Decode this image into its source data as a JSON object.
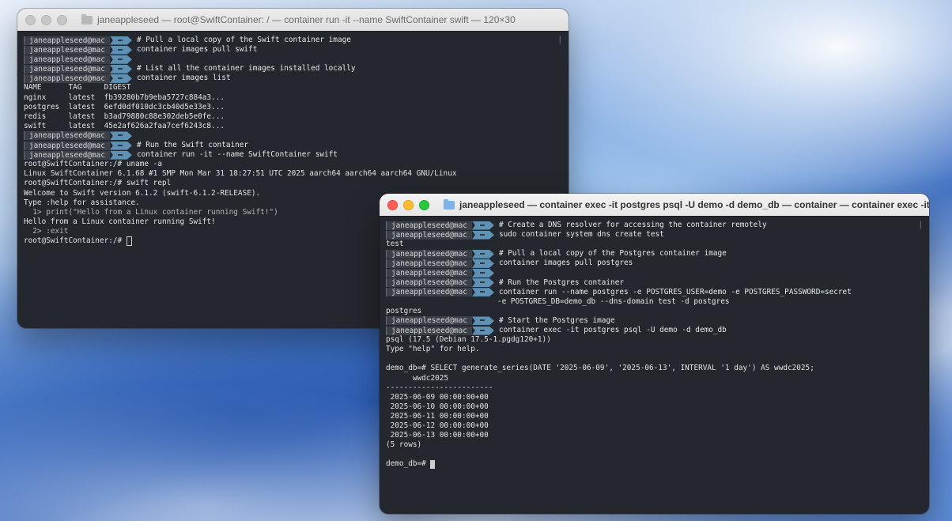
{
  "window1": {
    "title": "janeappleseed — root@SwiftContainer: / — container run -it --name SwiftContainer swift — 120×30",
    "user": "janeappleseed@mac",
    "tilde": "~",
    "lines": {
      "l1": "# Pull a local copy of the Swift container image",
      "l2": "container images pull swift",
      "l4": "# List all the container images installed locally",
      "l5": "container images list",
      "h": "NAME      TAG     DIGEST",
      "r1": "nginx     latest  fb39280b7b9eba5727c884a3...",
      "r2": "postgres  latest  6efd0df010dc3cb40d5e33e3...",
      "r3": "redis     latest  b3ad79880c88e302deb5e0fe...",
      "r4": "swift     latest  45e2af626a2faa7cef6243c8...",
      "l8": "# Run the Swift container",
      "l9": "container run -it --name SwiftContainer swift",
      "o1": "root@SwiftContainer:/# uname -a",
      "o2": "Linux SwiftContainer 6.1.68 #1 SMP Mon Mar 31 18:27:51 UTC 2025 aarch64 aarch64 aarch64 GNU/Linux",
      "o3": "root@SwiftContainer:/# swift repl",
      "o4": "Welcome to Swift version 6.1.2 (swift-6.1.2-RELEASE).",
      "o5": "Type :help for assistance.",
      "o6": "  1> print(\"Hello from a Linux container running Swift!\")",
      "o7": "Hello from a Linux container running Swift!",
      "o8": "  2> :exit",
      "o9": "root@SwiftContainer:/# "
    }
  },
  "window2": {
    "title": "janeappleseed — container exec -it postgres psql -U demo -d demo_db — container — container exec -it postgres ps...",
    "user": "janeappleseed@mac",
    "tilde": "~",
    "lines": {
      "a1": "# Create a DNS resolver for accessing the container remotely",
      "a2": "sudo container system dns create test",
      "a3": "test",
      "b1": "# Pull a local copy of the Postgres container image",
      "b2": "container images pull postgres",
      "c1": "# Run the Postgres container",
      "c2": "container run --name postgres -e POSTGRES_USER=demo -e POSTGRES_PASSWORD=secret",
      "c3": "-e POSTGRES_DB=demo_db --dns-domain test -d postgres",
      "c4": "postgres",
      "d1": "# Start the Postgres image",
      "d2": "container exec -it postgres psql -U demo -d demo_db",
      "d3": "psql (17.5 (Debian 17.5-1.pgdg120+1))",
      "d4": "Type \"help\" for help.",
      "q1": "demo_db=# SELECT generate_series(DATE '2025-06-09', '2025-06-13', INTERVAL '1 day') AS wwdc2025;",
      "q2": "      wwdc2025",
      "q3": "------------------------",
      "r1": " 2025-06-09 00:00:00+00",
      "r2": " 2025-06-10 00:00:00+00",
      "r3": " 2025-06-11 00:00:00+00",
      "r4": " 2025-06-12 00:00:00+00",
      "r5": " 2025-06-13 00:00:00+00",
      "r6": "(5 rows)",
      "p": "demo_db=# "
    }
  }
}
